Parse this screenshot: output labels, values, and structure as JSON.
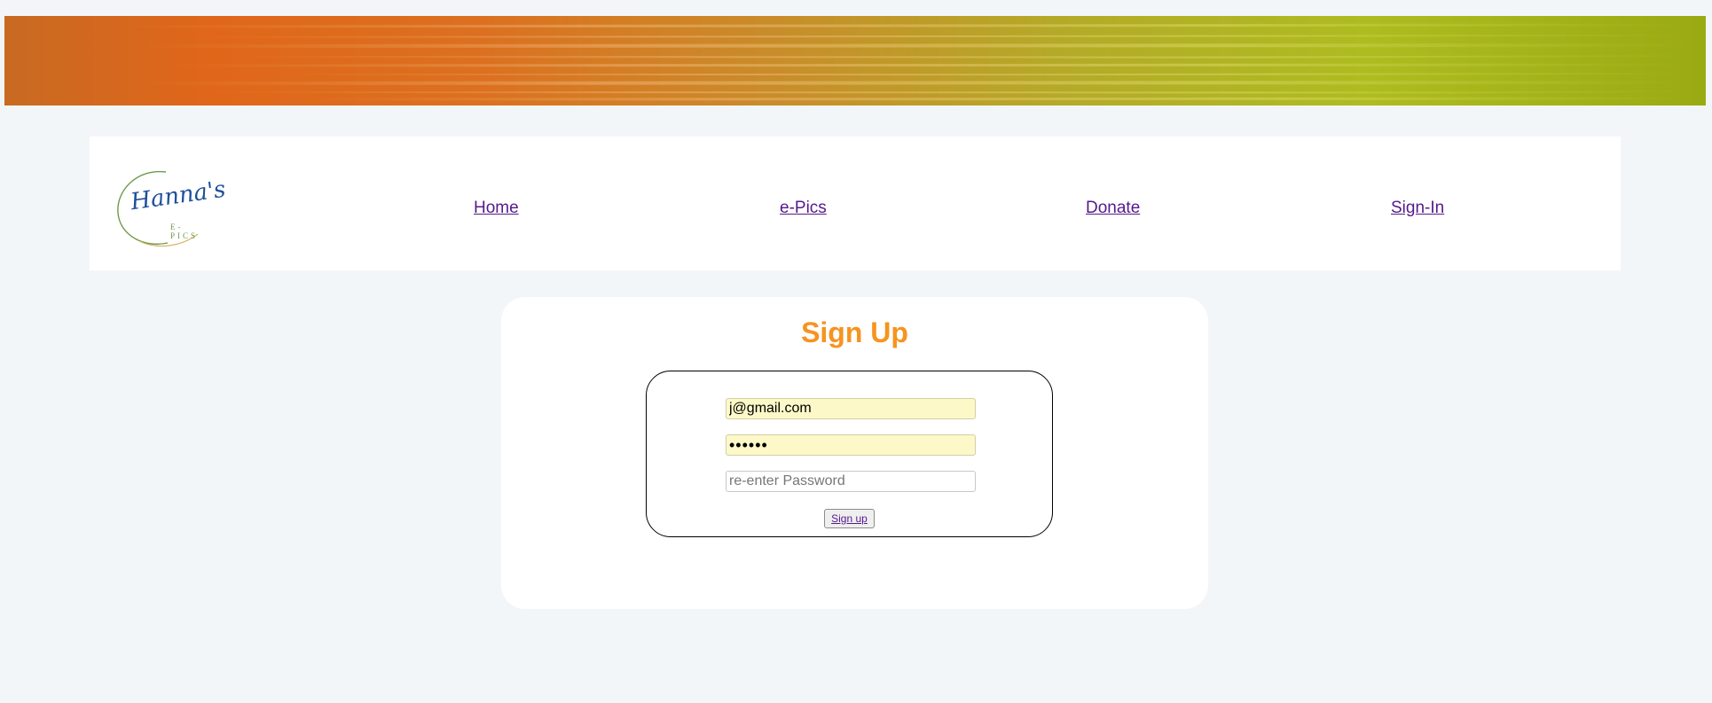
{
  "nav": {
    "logo": {
      "script_text": "Hanna's",
      "sub_text": "E-PICS"
    },
    "links": [
      {
        "label": "Home"
      },
      {
        "label": "e-Pics"
      },
      {
        "label": "Donate"
      },
      {
        "label": "Sign-In"
      }
    ]
  },
  "signup": {
    "title": "Sign Up",
    "email_value": "j@gmail.com",
    "password_value": "••••••",
    "reenter_placeholder": "re-enter Password",
    "submit_label": "Sign up"
  },
  "colors": {
    "title": "#f7931e",
    "link": "#551a8b",
    "autofill": "#fcf8c8",
    "page_background": "#f3f6f9"
  }
}
